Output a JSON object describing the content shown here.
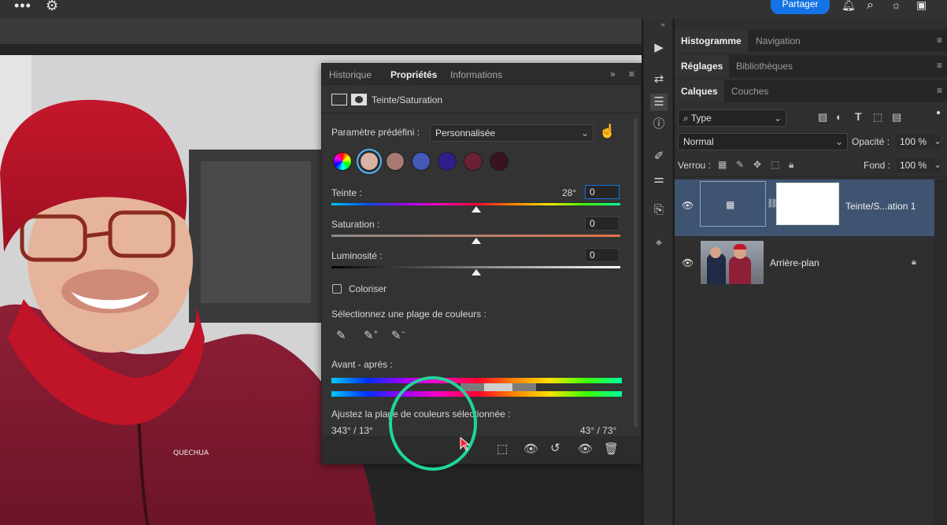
{
  "topbar": {
    "share_label": "Partager"
  },
  "properties": {
    "tabs": [
      "Historique",
      "Propriétés",
      "Informations"
    ],
    "adjustment_title": "Teinte/Saturation",
    "preset_label": "Paramètre prédéfini :",
    "preset_value": "Personnalisée",
    "swatch_colors": [
      "#d8b4a6",
      "#a87a72",
      "#4658b8",
      "#2e1f8f",
      "#6a2136",
      "#3b1220"
    ],
    "hue": {
      "label": "Teinte :",
      "degree_text": "28°",
      "value": "0"
    },
    "saturation": {
      "label": "Saturation :",
      "value": "0"
    },
    "lightness": {
      "label": "Luminosité :",
      "value": "0"
    },
    "colorize_label": "Coloriser",
    "select_range_label": "Sélectionnez une plage de couleurs :",
    "before_after_label": "Avant - après :",
    "adjust_range_label": "Ajustez la plage de couleurs sélectionnée :",
    "range_left": "343° / 13°",
    "range_right": "43° / 73°"
  },
  "right_panels": {
    "group1_tabs": [
      "Histogramme",
      "Navigation"
    ],
    "group2_tabs": [
      "Réglages",
      "Bibliothèques"
    ],
    "group3_tabs": [
      "Calques",
      "Couches"
    ],
    "filter_kind": "Type",
    "blend_mode": "Normal",
    "opacity_label": "Opacité :",
    "opacity_value": "100 %",
    "lock_label": "Verrou :",
    "fill_label": "Fond :",
    "fill_value": "100 %",
    "layers": [
      {
        "name": "Teinte/S...ation 1"
      },
      {
        "name": "Arrière-plan"
      }
    ]
  },
  "colors": {
    "accent": "#1473e6",
    "highlight_ring": "#1ed69a",
    "selected_layer": "#3f5471"
  },
  "photo": {
    "jacket_logo": "QUECHUA"
  }
}
